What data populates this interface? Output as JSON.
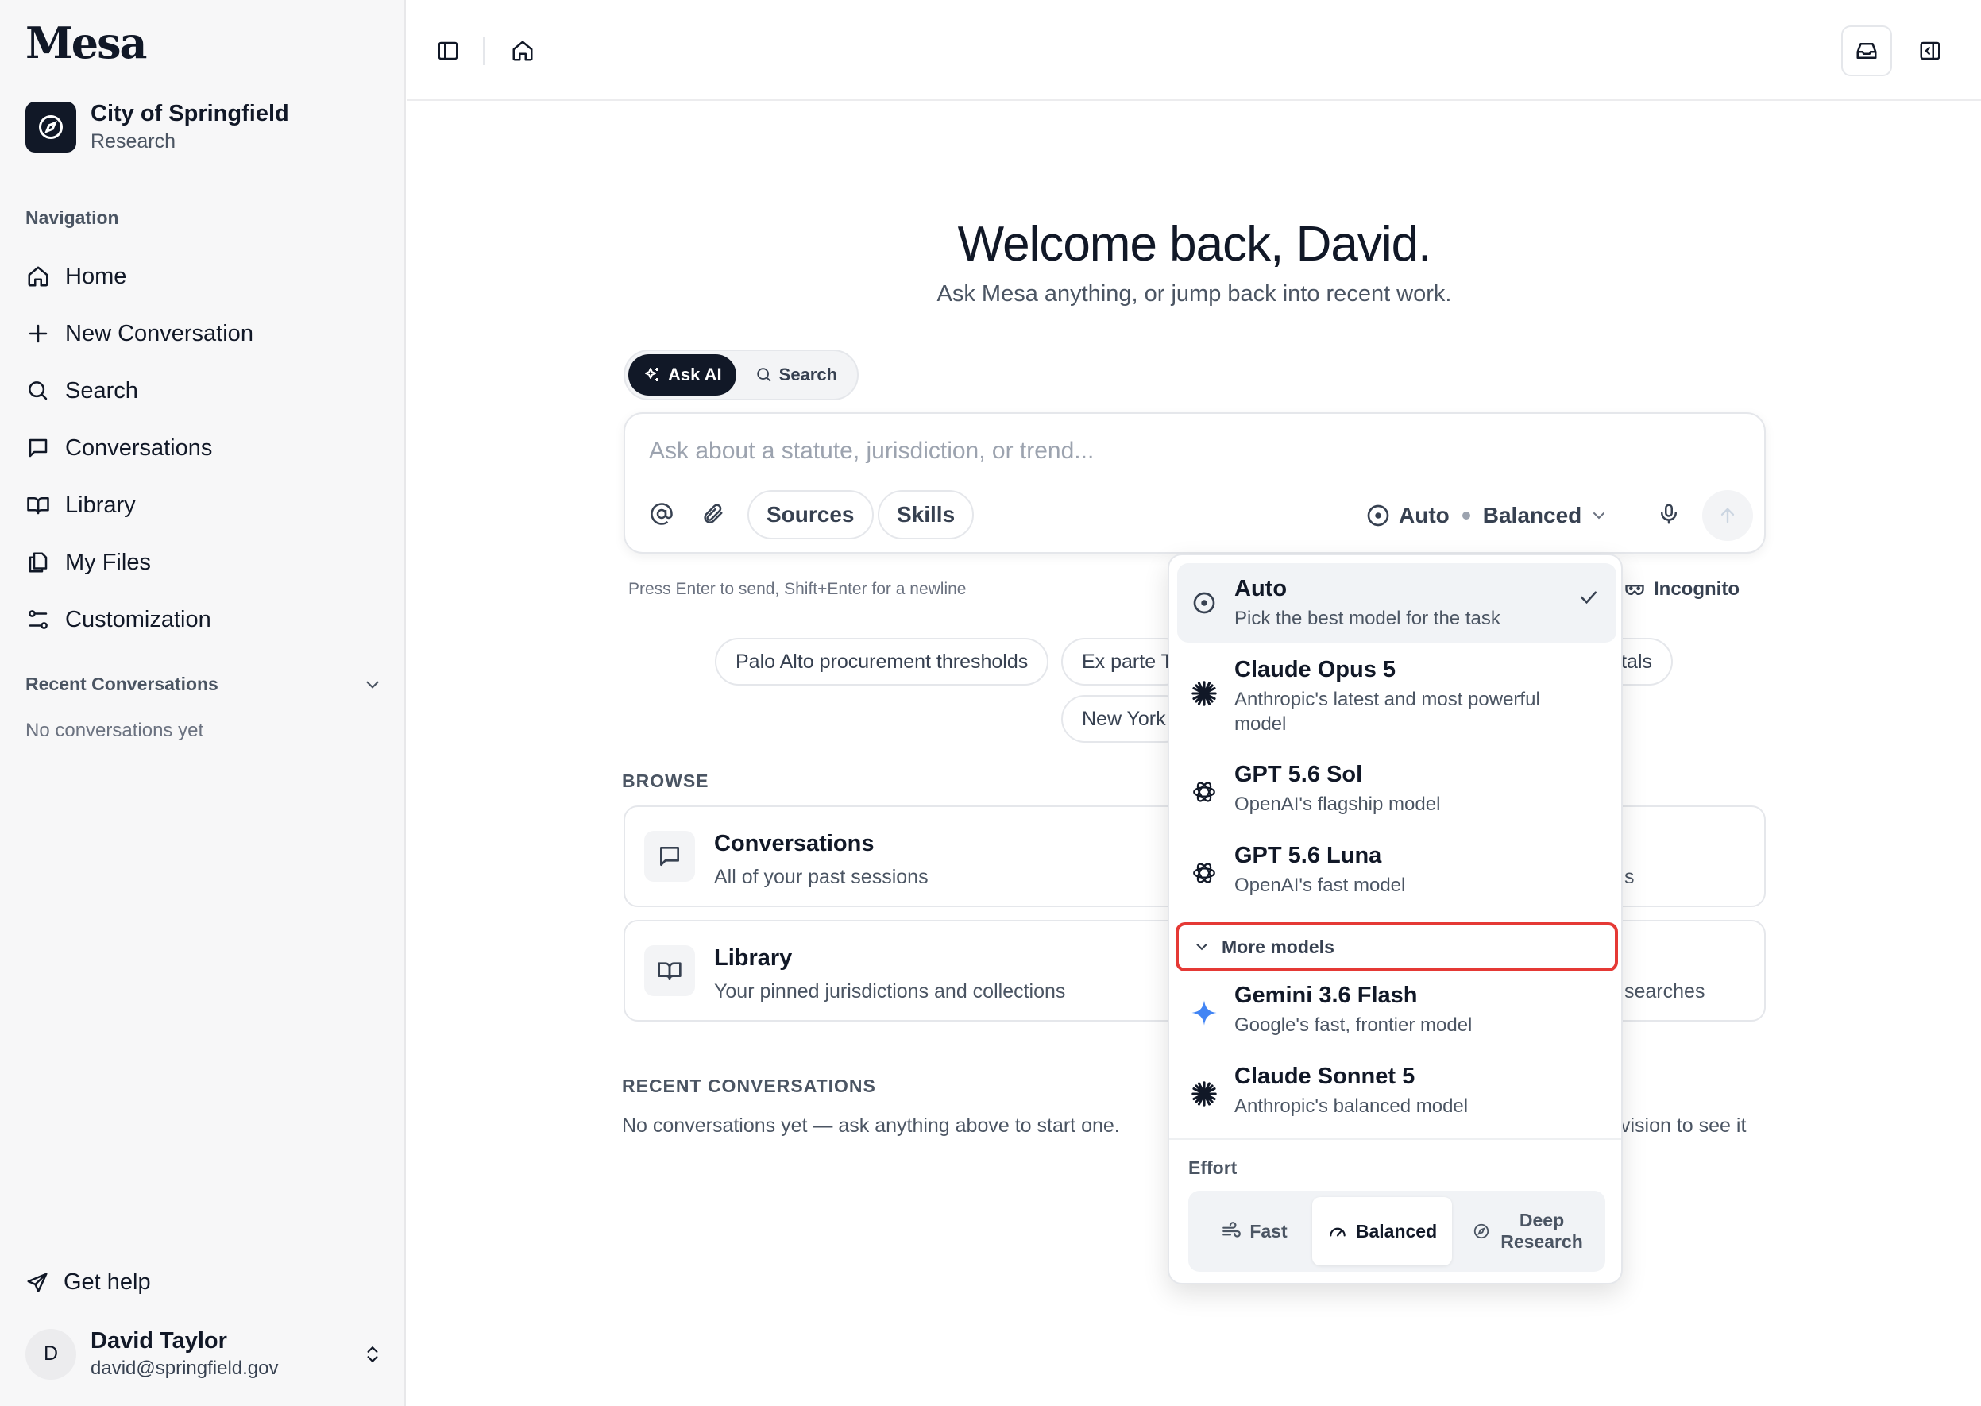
{
  "sidebar": {
    "logo": "Mesa",
    "org": {
      "name": "City of Springfield",
      "subtitle": "Research"
    },
    "nav_label": "Navigation",
    "nav": [
      {
        "label": "Home",
        "icon": "home-icon"
      },
      {
        "label": "New Conversation",
        "icon": "plus-icon"
      },
      {
        "label": "Search",
        "icon": "search-icon"
      },
      {
        "label": "Conversations",
        "icon": "chat-icon"
      },
      {
        "label": "Library",
        "icon": "book-icon"
      },
      {
        "label": "My Files",
        "icon": "files-icon"
      },
      {
        "label": "Customization",
        "icon": "sliders-icon"
      }
    ],
    "recent_label": "Recent Conversations",
    "recent_empty": "No conversations yet",
    "get_help": "Get help",
    "user": {
      "initial": "D",
      "name": "David Taylor",
      "email": "david@springfield.gov"
    }
  },
  "main": {
    "welcome": "Welcome back, David.",
    "subtitle": "Ask Mesa anything, or jump back into recent work.",
    "modes": {
      "ask_ai": "Ask AI",
      "search": "Search",
      "active": "Ask AI"
    },
    "composer": {
      "placeholder": "Ask about a statute, jurisdiction, or trend...",
      "sources": "Sources",
      "skills": "Skills",
      "model": "Auto",
      "effort": "Balanced"
    },
    "hint": "Press Enter to send, Shift+Enter for a newline",
    "incognito": "Incognito",
    "suggestions": [
      "Palo Alto procurement thresholds",
      "Ex parte T",
      "tals",
      "New York"
    ],
    "browse_label": "BROWSE",
    "cards": [
      {
        "title": "Conversations",
        "subtitle": "All of your past sessions",
        "right_text": "s"
      },
      {
        "title": "Library",
        "subtitle": "Your pinned jurisdictions and collections",
        "right_text": "searches"
      }
    ],
    "recent_label": "RECENT CONVERSATIONS",
    "recent_empty": "No conversations yet — ask anything above to start one.",
    "recent_right": "vision to see it"
  },
  "model_menu": {
    "options": [
      {
        "name": "Auto",
        "desc": "Pick the best model for the task",
        "icon": "auto-icon",
        "selected": true
      },
      {
        "name": "Claude Opus 5",
        "desc": "Anthropic's latest and most powerful model",
        "icon": "anthropic-icon"
      },
      {
        "name": "GPT 5.6 Sol",
        "desc": "OpenAI's flagship model",
        "icon": "openai-icon"
      },
      {
        "name": "GPT 5.6 Luna",
        "desc": "OpenAI's fast model",
        "icon": "openai-icon"
      }
    ],
    "more_models": "More models",
    "more_options": [
      {
        "name": "Gemini 3.6 Flash",
        "desc": "Google's fast, frontier model",
        "icon": "gemini-icon"
      },
      {
        "name": "Claude Sonnet 5",
        "desc": "Anthropic's balanced model",
        "icon": "anthropic-icon"
      }
    ],
    "effort_label": "Effort",
    "effort_options": [
      "Fast",
      "Balanced",
      "Deep Research"
    ],
    "effort_selected": "Balanced"
  },
  "colors": {
    "highlight_outline": "#e53935",
    "dark": "#111827",
    "gemini_blue": "#4285f4"
  }
}
